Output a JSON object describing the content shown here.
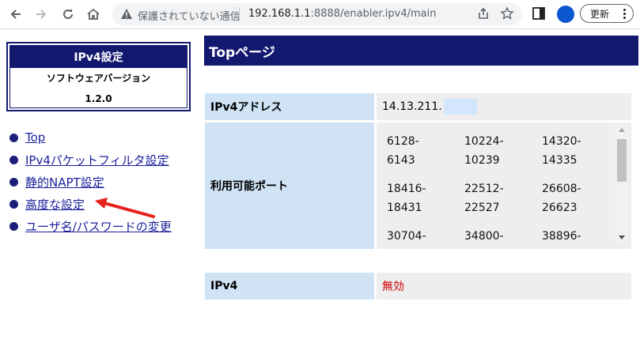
{
  "browser": {
    "security_label": "保護されていない通信",
    "url_host": "192.168.1.1",
    "url_rest": ":8888/enabler.ipv4/main",
    "update_label": "更新",
    "avatar_color": "#0b57d0"
  },
  "sidebar": {
    "box_title": "IPv4設定",
    "software_version_label": "ソフトウェアバージョン",
    "version": "1.2.0",
    "nav": [
      {
        "label": "Top"
      },
      {
        "label": "IPv4パケットフィルタ設定"
      },
      {
        "label": "静的NAPT設定"
      },
      {
        "label": "高度な設定"
      },
      {
        "label": "ユーザ名/パスワードの変更"
      }
    ]
  },
  "main": {
    "page_title": "Topページ",
    "ipv4_address_label": "IPv4アドレス",
    "ipv4_address_value": "14.13.211.",
    "ports_label": "利用可能ポート",
    "ports": [
      [
        "6128-",
        "6143"
      ],
      [
        "10224-",
        "10239"
      ],
      [
        "14320-",
        "14335"
      ],
      [
        "18416-",
        "18431"
      ],
      [
        "22512-",
        "22527"
      ],
      [
        "26608-",
        "26623"
      ],
      [
        "30704-",
        ""
      ],
      [
        "34800-",
        ""
      ],
      [
        "38896-",
        ""
      ]
    ],
    "ipv4_status_label": "IPv4",
    "ipv4_status_value": "無効",
    "status_color": "#cc0000"
  },
  "colors": {
    "header_navy": "#141970",
    "label_blue": "#cfe3f5",
    "annotation_red": "#e8201c"
  }
}
